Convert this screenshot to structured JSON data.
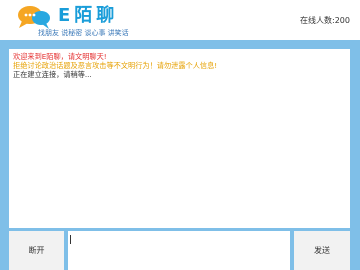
{
  "header": {
    "logo_text": "E陌聊",
    "tagline": "找朋友 说秘密 谈心事 讲笑话",
    "online_label": "在线人数:",
    "online_count": "200"
  },
  "chat": {
    "messages": [
      {
        "text": "欢迎来到E陌聊，请文明聊天!"
      },
      {
        "text": "拒绝讨论政治话题及恶言攻击等不文明行为！请勿泄露个人信息!"
      },
      {
        "text": "正在建立连接，请稍等..."
      }
    ]
  },
  "controls": {
    "disconnect_label": "断开",
    "send_label": "发送",
    "input_value": ""
  },
  "colors": {
    "frame": "#7fbfe8",
    "welcome": "#e53030",
    "warning": "#e6a000",
    "brand": "#1a9dd9"
  }
}
